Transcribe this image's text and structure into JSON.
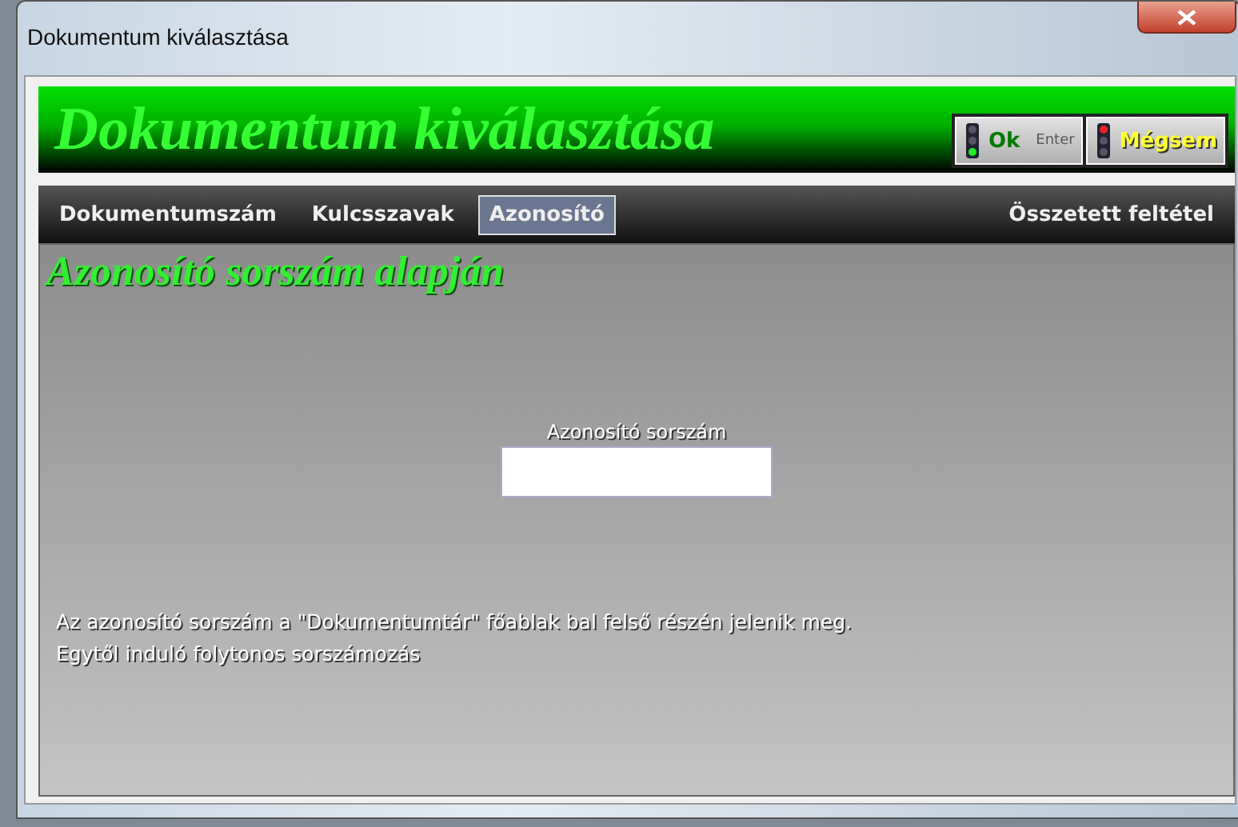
{
  "window": {
    "title": "Dokumentum kiválasztása"
  },
  "header": {
    "title": "Dokumentum kiválasztása",
    "buttons": [
      {
        "kind": "ok",
        "label": "Ok",
        "hint": "Enter"
      },
      {
        "kind": "cancel",
        "label": "Mégsem"
      }
    ]
  },
  "tabs": [
    {
      "label": "Dokumentumszám",
      "selected": false
    },
    {
      "label": "Kulcsszavak",
      "selected": false
    },
    {
      "label": "Azonosító",
      "selected": true
    },
    {
      "label": "Összetett feltétel",
      "selected": false
    }
  ],
  "section_title": "Azonosító sorszám alapján",
  "field": {
    "label": "Azonosító sorszám"
  },
  "help_lines": [
    "Az azonosító sorszám a \"Dokumentumtár\" főablak bal felső részén jelenik meg.",
    "Egytől induló folytonos sorszámozás"
  ]
}
